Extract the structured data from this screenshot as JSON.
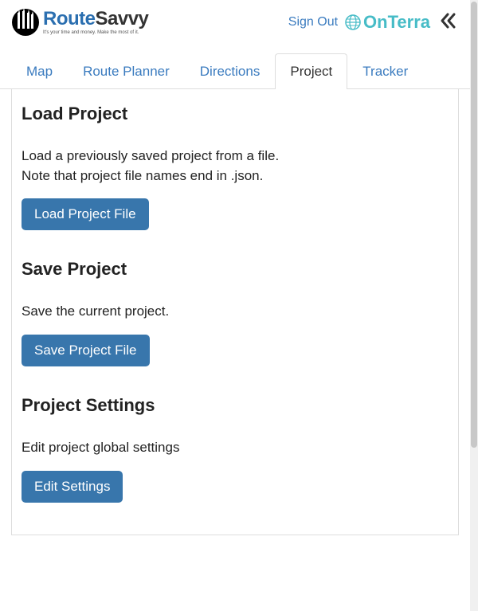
{
  "header": {
    "logo": {
      "prefix": "Route",
      "suffix": "Savvy",
      "tagline": "It's your time and money. Make the most of it."
    },
    "sign_out": "Sign Out",
    "partner_logo": "OnTerra"
  },
  "tabs": [
    {
      "label": "Map",
      "active": false
    },
    {
      "label": "Route Planner",
      "active": false
    },
    {
      "label": "Directions",
      "active": false
    },
    {
      "label": "Project",
      "active": true
    },
    {
      "label": "Tracker",
      "active": false
    }
  ],
  "sections": {
    "load": {
      "title": "Load Project",
      "line1": "Load a previously saved project from a file.",
      "line2": "Note that project file names end in .json.",
      "button": "Load Project File"
    },
    "save": {
      "title": "Save Project",
      "text": "Save the current project.",
      "button": "Save Project File"
    },
    "settings": {
      "title": "Project Settings",
      "text": "Edit project global settings",
      "button": "Edit Settings"
    }
  }
}
